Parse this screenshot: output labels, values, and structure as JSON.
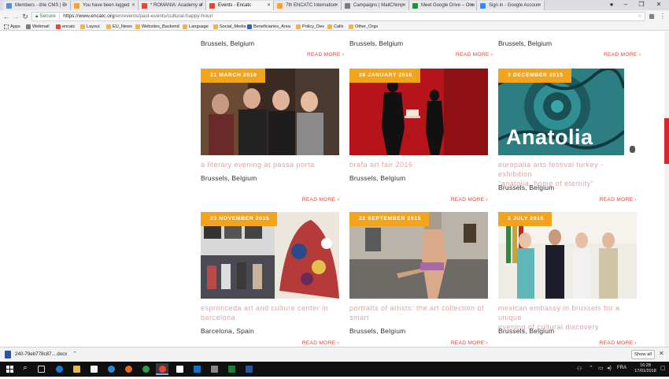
{
  "tabs": [
    {
      "label": "Members - drie CMS | E",
      "color": "#5b8ecf",
      "active": false
    },
    {
      "label": "You have been logged",
      "color": "#f0a33a",
      "active": false
    },
    {
      "label": "* ROMANIA: Academy of",
      "color": "#d94b3a",
      "active": false
    },
    {
      "label": "Events - Encatc",
      "color": "#d94b3a",
      "active": true
    },
    {
      "label": "7th ENCATC Internation",
      "color": "#f0a33a",
      "active": false
    },
    {
      "label": "Campaigns | MailChimp",
      "color": "#7b7b7b",
      "active": false
    },
    {
      "label": "Meet Google Drive – One",
      "color": "#2b8a3e",
      "active": false
    },
    {
      "label": "Sign in - Google Accoun",
      "color": "#4285f4",
      "active": false
    }
  ],
  "address": {
    "secure_label": "Secure",
    "url_host": "https://www.encatc.org",
    "url_path": "/en/events/past-events/cultural-happy-hour/"
  },
  "bookmarks": [
    {
      "label": "Apps",
      "icon": "apps-grid-icon"
    },
    {
      "label": "Webmail",
      "icon": "webmail-icon"
    },
    {
      "label": "encatc",
      "icon": "encatc-icon"
    },
    {
      "label": "Layout",
      "icon": "folder-icon"
    },
    {
      "label": "EU_News",
      "icon": "folder-icon"
    },
    {
      "label": "Websites_Backend",
      "icon": "folder-icon"
    },
    {
      "label": "Language",
      "icon": "folder-icon"
    },
    {
      "label": "Social_Media",
      "icon": "folder-icon"
    },
    {
      "label": "Beneficiaries_Area",
      "icon": "eu-flag-icon"
    },
    {
      "label": "Policy_Dev",
      "icon": "folder-icon"
    },
    {
      "label": "Calls",
      "icon": "folder-icon"
    },
    {
      "label": "Other_Orgs",
      "icon": "folder-icon"
    }
  ],
  "top_row": [
    {
      "location": "Brussels, Belgium",
      "read_more": "READ MORE ›"
    },
    {
      "location": "Brussels, Belgium",
      "read_more": "READ MORE ›"
    },
    {
      "location": "Brussels, Belgium",
      "read_more": "READ MORE ›"
    }
  ],
  "events": [
    {
      "date": "21 MARCH 2016",
      "title": "a literary evening at passa porta",
      "title2": "",
      "location": "Brussels, Belgium",
      "read_more": "READ MORE ›"
    },
    {
      "date": "28 JANUARY 2016",
      "title": "brafa art fair 2016",
      "title2": "",
      "location": "Brussels, Belgium",
      "read_more": "READ MORE ›"
    },
    {
      "date": "3 DECEMBER 2015",
      "title": "europalia arts festival turkey - exhibition",
      "title2": "\"anatolia, home of eternity\"",
      "location": "Brussels, Belgium",
      "read_more": "READ MORE ›",
      "overlay": "Anatolia"
    },
    {
      "date": "23 NOVEMBER 2015",
      "title": "espronceda art and culture center in",
      "title2": "barcelona",
      "location": "Barcelona, Spain",
      "read_more": "READ MORE ›"
    },
    {
      "date": "22 SEPTEMBER 2015",
      "title": "portraits of artists: the art collection of",
      "title2": "smart",
      "location": "Brussels, Belgium",
      "read_more": "READ MORE ›"
    },
    {
      "date": "3 JULY 2015",
      "title": "mexican embassy in brussels for a unique",
      "title2": "evening of cultural discovery",
      "location": "Brussels, Belgium",
      "read_more": "READ MORE ›"
    }
  ],
  "download": {
    "filename": "240-79eb778c87....docx",
    "show_all": "Show all"
  },
  "taskbar": {
    "time": "16:28",
    "date": "17/01/2018",
    "lang": "FRA"
  },
  "colors": {
    "accent": "#f2a41a",
    "title_pink": "#e8a0a0",
    "read_more_red": "#e0443a",
    "scroll_red": "#d8262a"
  }
}
